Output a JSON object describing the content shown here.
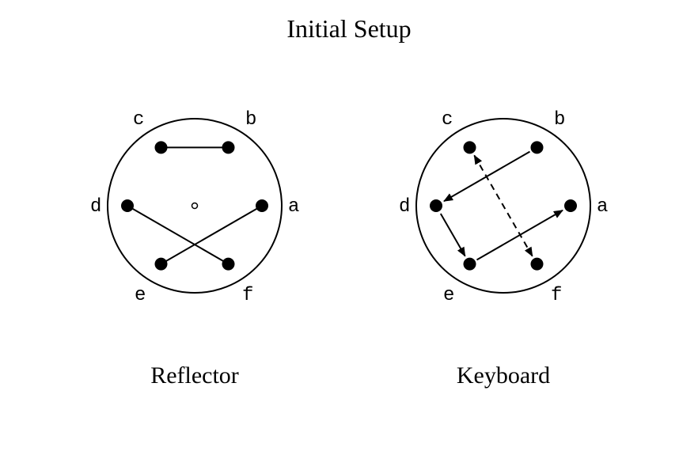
{
  "title": "Initial Setup",
  "left": {
    "caption": "Reflector",
    "nodes": {
      "a": "a",
      "b": "b",
      "c": "c",
      "d": "d",
      "e": "e",
      "f": "f"
    }
  },
  "right": {
    "caption": "Keyboard",
    "nodes": {
      "a": "a",
      "b": "b",
      "c": "c",
      "d": "d",
      "e": "e",
      "f": "f"
    }
  },
  "chart_data": {
    "type": "diagram",
    "title": "Initial Setup",
    "wheels": [
      {
        "name": "Reflector",
        "nodes": [
          "a",
          "b",
          "c",
          "d",
          "e",
          "f"
        ],
        "edges": [
          {
            "from": "c",
            "to": "b",
            "style": "line"
          },
          {
            "from": "d",
            "to": "f",
            "style": "line"
          },
          {
            "from": "a",
            "to": "e",
            "style": "line"
          }
        ],
        "center_dot": true
      },
      {
        "name": "Keyboard",
        "nodes": [
          "a",
          "b",
          "c",
          "d",
          "e",
          "f"
        ],
        "edges": [
          {
            "from": "b",
            "to": "d",
            "style": "arrow"
          },
          {
            "from": "d",
            "to": "e",
            "style": "arrow"
          },
          {
            "from": "e",
            "to": "a",
            "style": "arrow"
          },
          {
            "from": "c",
            "to": "f",
            "style": "dashed-arrow-both"
          }
        ],
        "center_dot": false
      }
    ]
  }
}
